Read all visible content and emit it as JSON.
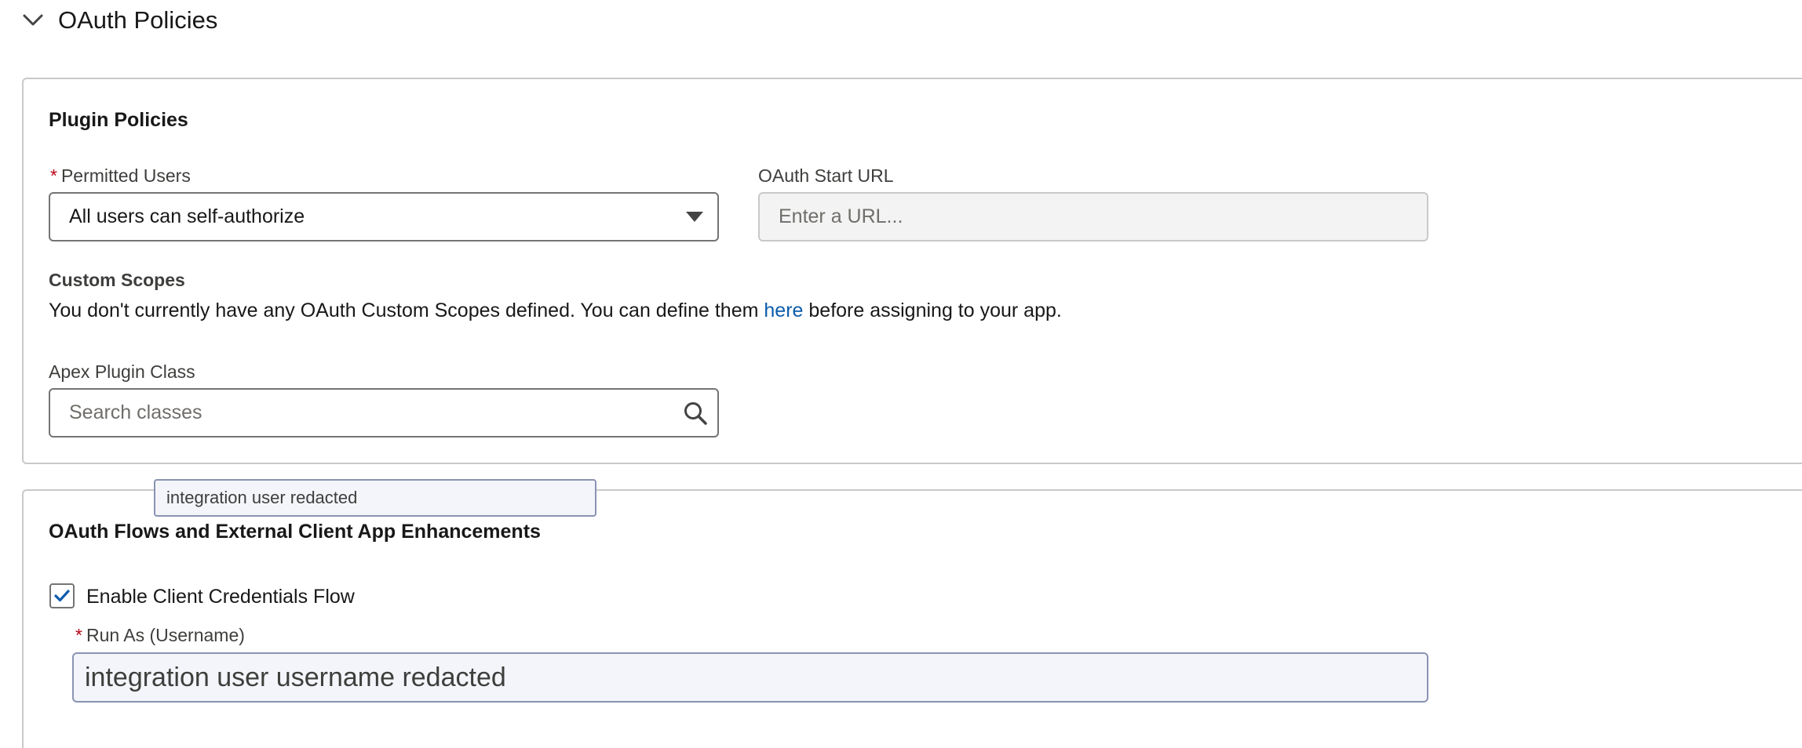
{
  "section": {
    "title": "OAuth Policies",
    "toggle_icon": "chevron-down-icon"
  },
  "plugin_policies": {
    "title": "Plugin Policies",
    "permitted_users": {
      "required_mark": "*",
      "label": "Permitted Users",
      "value": "All users can self-authorize"
    },
    "oauth_start_url": {
      "label": "OAuth Start URL",
      "placeholder": "Enter a URL..."
    },
    "custom_scopes": {
      "heading": "Custom Scopes",
      "text_before": "You don't currently have any OAuth Custom Scopes defined. You can define them ",
      "link_text": "here",
      "text_after": " before assigning to your app."
    },
    "apex_plugin_class": {
      "label": "Apex Plugin Class",
      "placeholder": "Search classes"
    }
  },
  "tooltip": {
    "text": "integration user redacted"
  },
  "oauth_flows": {
    "title": "OAuth Flows and External Client App Enhancements",
    "client_credentials": {
      "label": "Enable Client Credentials Flow",
      "checked": true
    },
    "run_as": {
      "required_mark": "*",
      "label": "Run As (Username)",
      "value": "integration user username redacted"
    }
  },
  "colors": {
    "required": "#ba0517",
    "link": "#0b5cab",
    "checkmark": "#0b5cab",
    "border": "#747474"
  }
}
